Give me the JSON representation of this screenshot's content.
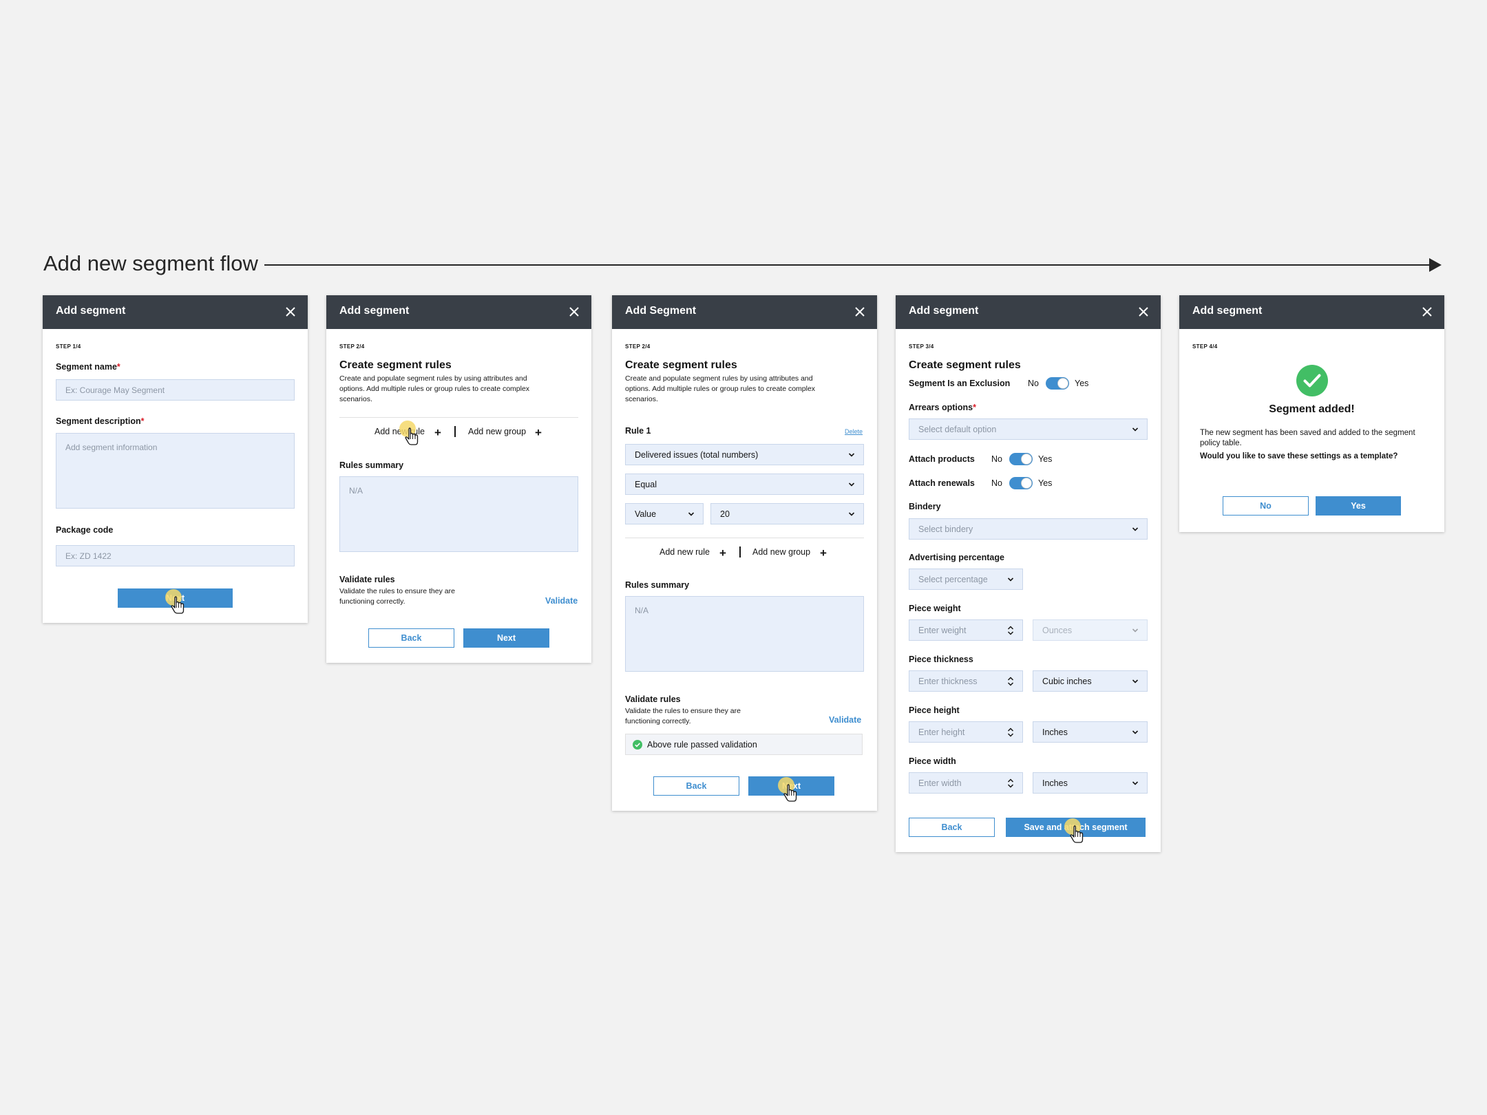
{
  "flow": {
    "title": "Add new segment flow"
  },
  "panel1": {
    "title": "Add segment",
    "step": "STEP 1/4",
    "segment_name_label": "Segment name",
    "segment_name_placeholder": "Ex: Courage May Segment",
    "segment_desc_label": "Segment description",
    "segment_desc_placeholder": "Add segment information",
    "package_code_label": "Package code",
    "package_code_placeholder": "Ex: ZD 1422",
    "required_mark": "*",
    "next": "Next"
  },
  "panel2": {
    "title": "Add segment",
    "step": "STEP 2/4",
    "heading": "Create segment rules",
    "description": "Create and populate segment rules by using attributes and options. Add multiple rules or group rules to create complex scenarios.",
    "add_rule": "Add new rule",
    "add_group": "Add new group",
    "rules_summary_label": "Rules summary",
    "rules_summary_value": "N/A",
    "validate_heading": "Validate rules",
    "validate_desc": "Validate the rules to ensure they are functioning correctly.",
    "validate_link": "Validate",
    "back": "Back",
    "next": "Next"
  },
  "panel3": {
    "title": "Add Segment",
    "step": "STEP 2/4",
    "heading": "Create segment rules",
    "description": "Create and populate segment rules by using attributes and options. Add multiple rules or group rules to create complex scenarios.",
    "rule_label": "Rule 1",
    "delete_link": "Delete",
    "attribute_select": "Delivered issues (total numbers)",
    "operator_select": "Equal",
    "value_type_select": "Value",
    "value_select": "20",
    "add_rule": "Add new rule",
    "add_group": "Add new group",
    "rules_summary_label": "Rules summary",
    "rules_summary_value": "N/A",
    "validate_heading": "Validate rules",
    "validate_desc": "Validate the rules to ensure they are functioning correctly.",
    "validate_link": "Validate",
    "validation_message": "Above rule passed validation",
    "success_color": "#42be65",
    "back": "Back",
    "next": "Next"
  },
  "panel4": {
    "title": "Add segment",
    "step": "STEP 3/4",
    "heading": "Create segment rules",
    "exclusion_label": "Segment Is an Exclusion",
    "no": "No",
    "yes": "Yes",
    "arrears_label": "Arrears options",
    "arrears_placeholder": "Select default option",
    "attach_products_label": "Attach products",
    "attach_renewals_label": "Attach renewals",
    "bindery_label": "Bindery",
    "bindery_placeholder": "Select bindery",
    "advertising_label": "Advertising percentage",
    "advertising_placeholder": "Select percentage",
    "piece_weight_label": "Piece weight",
    "piece_weight_placeholder": "Enter weight",
    "piece_weight_unit": "Ounces",
    "piece_thickness_label": "Piece thickness",
    "piece_thickness_placeholder": "Enter thickness",
    "piece_thickness_unit": "Cubic inches",
    "piece_height_label": "Piece height",
    "piece_height_placeholder": "Enter height",
    "piece_height_unit": "Inches",
    "piece_width_label": "Piece width",
    "piece_width_placeholder": "Enter width",
    "piece_width_unit": "Inches",
    "back": "Back",
    "save": "Save and attach segment"
  },
  "panel5": {
    "title": "Add segment",
    "step": "STEP 4/4",
    "success_heading": "Segment added!",
    "success_message": "The new segment has been saved and added to the segment policy table.",
    "question": "Would you like to save these settings as a template?",
    "no": "No",
    "yes": "Yes",
    "success_color": "#42be65"
  },
  "colors": {
    "header": "#393f47",
    "primary": "#3f8ecf",
    "input_bg": "#e8effa",
    "cursor_highlight": "#f5d86a"
  }
}
